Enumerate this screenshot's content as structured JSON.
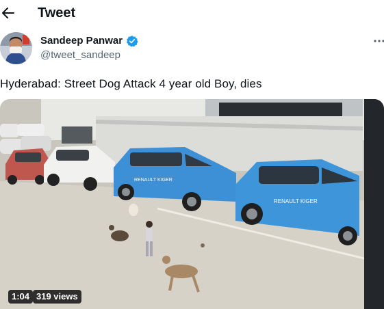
{
  "header": {
    "title": "Tweet",
    "back_icon": "arrow-left-icon"
  },
  "author": {
    "name": "Sandeep Panwar",
    "handle": "@tweet_sandeep",
    "verified": true,
    "verified_color": "#1d9bf0"
  },
  "tweet": {
    "text": "Hyderabad: Street Dog Attack 4 year old Boy, dies"
  },
  "media": {
    "type": "video",
    "duration": "1:04",
    "views": "319 views",
    "overlay_text": "RENAULT KIGER"
  },
  "colors": {
    "text": "#0f1419",
    "secondary": "#536471",
    "accent": "#1d9bf0"
  }
}
